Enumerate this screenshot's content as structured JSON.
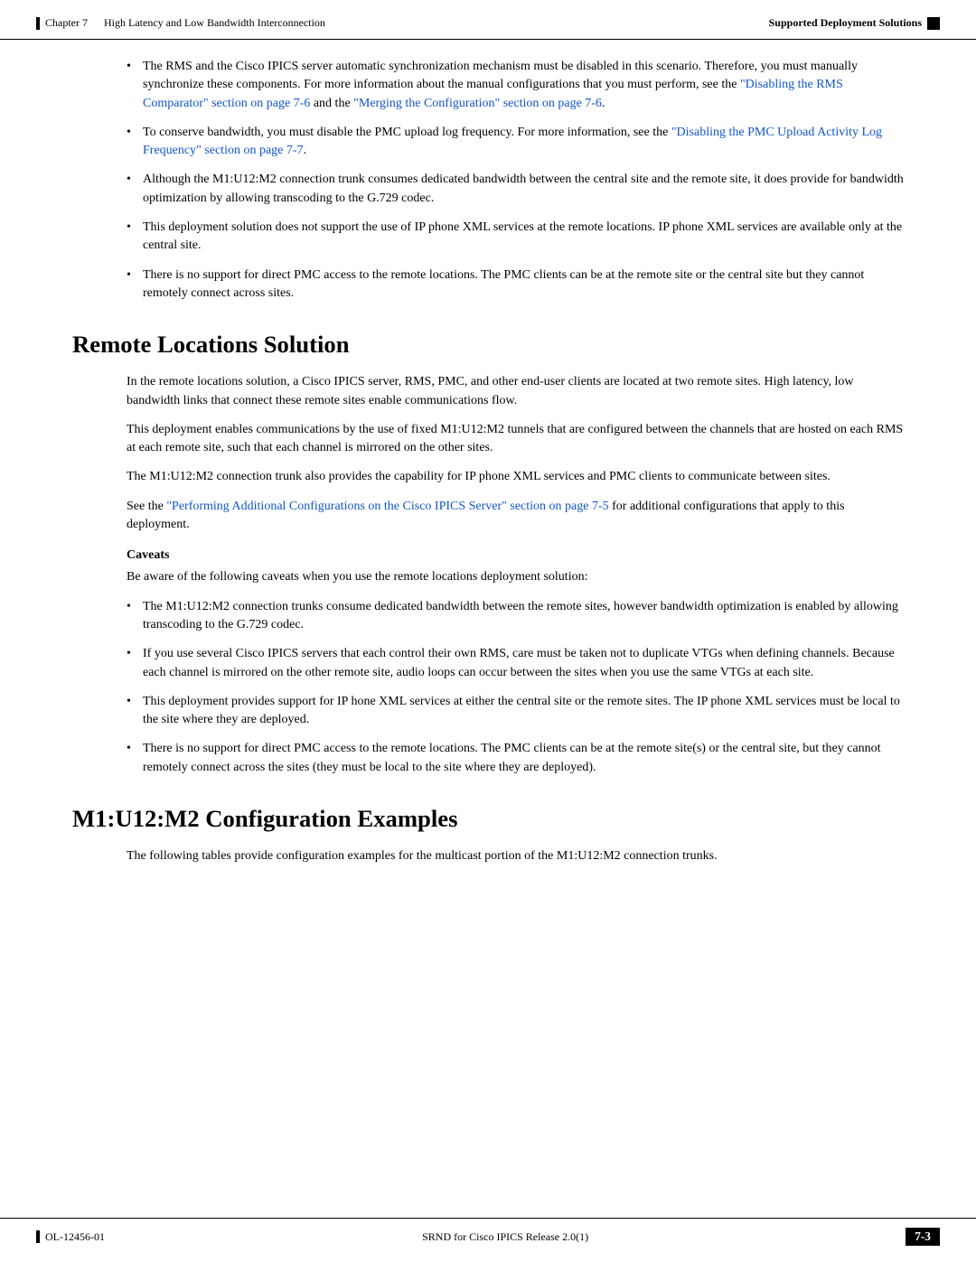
{
  "header": {
    "left_bar": true,
    "chapter_label": "Chapter 7",
    "chapter_title": "High Latency and Low Bandwidth Interconnection",
    "right_title": "Supported Deployment Solutions",
    "right_bar": true
  },
  "footer": {
    "left_bar": true,
    "doc_number": "OL-12456-01",
    "right_label": "SRND for Cisco IPICS Release 2.0(1)",
    "page_number": "7-3"
  },
  "bullet_items_top": [
    {
      "text_before": "The RMS and the Cisco IPICS server automatic synchronization mechanism must be disabled in this scenario. Therefore, you must manually synchronize these components. For more information about the manual configurations that you must perform, see the ",
      "link1_text": "\"Disabling the RMS Comparator\" section on page 7-6",
      "link1_href": "#",
      "text_mid": " and the ",
      "link2_text": "\"Merging the Configuration\" section on page 7-6",
      "link2_href": "#",
      "text_after": "."
    },
    {
      "text_before": "To conserve bandwidth, you must disable the PMC upload log frequency. For more information, see the ",
      "link1_text": "\"Disabling the PMC Upload Activity Log Frequency\" section on page 7-7",
      "link1_href": "#",
      "text_after": "."
    },
    {
      "text_plain": "Although the M1:U12:M2 connection trunk consumes dedicated bandwidth between the central site and the remote site, it does provide for bandwidth optimization by allowing transcoding to the G.729 codec."
    },
    {
      "text_plain": "This deployment solution does not support the use of IP phone XML services at the remote locations. IP phone XML services are available only at the central site."
    },
    {
      "text_plain": "There is no support for direct PMC access to the remote locations. The PMC clients can be at the remote site or the central site but they cannot remotely connect across sites."
    }
  ],
  "remote_section": {
    "heading": "Remote Locations Solution",
    "paragraphs": [
      "In the remote locations solution, a Cisco IPICS server, RMS, PMC, and other end-user clients are located at two remote sites. High latency, low bandwidth links that connect these remote sites enable communications flow.",
      "This deployment enables communications by the use of fixed M1:U12:M2 tunnels that are configured between the channels that are hosted on each RMS at each remote site, such that each channel is mirrored on the other sites.",
      "The M1:U12:M2 connection trunk also provides the capability for IP phone XML services and PMC clients to communicate between sites."
    ],
    "see_also": {
      "text_before": "See the ",
      "link_text": "\"Performing Additional Configurations on the Cisco IPICS Server\" section on page 7-5",
      "link_href": "#",
      "text_after": " for additional configurations that apply to this deployment."
    },
    "caveats_heading": "Caveats",
    "caveats_intro": "Be aware of the following caveats when you use the remote locations deployment solution:",
    "caveats": [
      "The M1:U12:M2 connection trunks consume dedicated bandwidth between the remote sites, however bandwidth optimization is enabled by allowing transcoding to the G.729 codec.",
      "If you use several Cisco IPICS servers that each control their own RMS, care must be taken not to duplicate VTGs when defining channels. Because each channel is mirrored on the other remote site, audio loops can occur between the sites when you use the same VTGs at each site.",
      "This deployment provides support for IP hone XML services at either the central site or the remote sites. The IP phone XML services must be local to the site where they are deployed.",
      "There is no support for direct PMC access to the remote locations. The PMC clients can be at the remote site(s) or the central site, but they cannot remotely connect across the sites (they must be local to the site where they are deployed)."
    ]
  },
  "m1_section": {
    "heading": "M1:U12:M2 Configuration Examples",
    "paragraph": "The following tables provide configuration examples for the multicast portion of the M1:U12:M2 connection trunks."
  }
}
